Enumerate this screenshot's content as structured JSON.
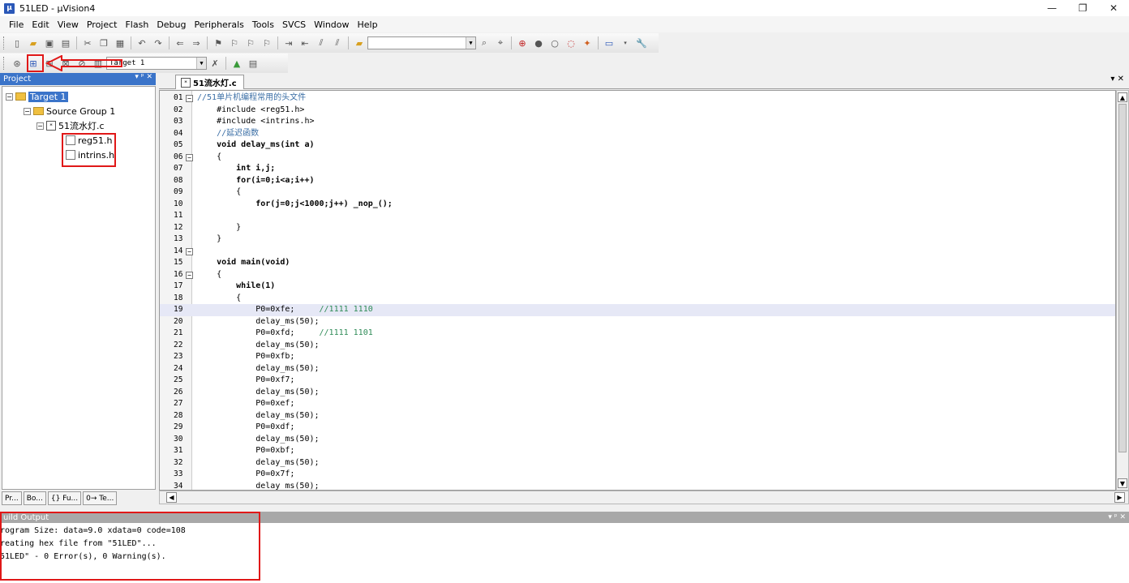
{
  "window": {
    "title": "51LED  - µVision4",
    "controls": {
      "minimize": "—",
      "restore": "❐",
      "close": "✕"
    }
  },
  "menu": [
    "File",
    "Edit",
    "View",
    "Project",
    "Flash",
    "Debug",
    "Peripherals",
    "Tools",
    "SVCS",
    "Window",
    "Help"
  ],
  "toolbar": {
    "target_select": "Target 1"
  },
  "project_panel": {
    "title": "Project",
    "controls": "▾ ᵖ ✕",
    "tree": {
      "target": "Target 1",
      "group": "Source Group 1",
      "file": "51流水灯.c",
      "includes": [
        "reg51.h",
        "intrins.h"
      ]
    },
    "tabs": [
      "Pr...",
      "Bo...",
      "{} Fu...",
      "0→ Te..."
    ]
  },
  "editor": {
    "tab_label": "51流水灯.c",
    "close_label": "▾ ✕",
    "highlight_line": "19",
    "lines": [
      {
        "n": "01",
        "t": "//51单片机编程常用的头文件"
      },
      {
        "n": "02",
        "t": "    #include <reg51.h>"
      },
      {
        "n": "03",
        "t": "    #include <intrins.h>"
      },
      {
        "n": "04",
        "t": "    //延迟函数"
      },
      {
        "n": "05",
        "t": "    void delay_ms(int a)"
      },
      {
        "n": "06",
        "t": "    {"
      },
      {
        "n": "07",
        "t": "        int i,j;"
      },
      {
        "n": "08",
        "t": "        for(i=0;i<a;i++)"
      },
      {
        "n": "09",
        "t": "        {"
      },
      {
        "n": "10",
        "t": "            for(j=0;j<1000;j++) _nop_();"
      },
      {
        "n": "11",
        "t": ""
      },
      {
        "n": "12",
        "t": "        }"
      },
      {
        "n": "13",
        "t": "    }"
      },
      {
        "n": "14",
        "t": ""
      },
      {
        "n": "15",
        "t": "    void main(void)"
      },
      {
        "n": "16",
        "t": "    {"
      },
      {
        "n": "17",
        "t": "        while(1)"
      },
      {
        "n": "18",
        "t": "        {"
      },
      {
        "n": "19",
        "t": "            P0=0xfe;     //1111 1110"
      },
      {
        "n": "20",
        "t": "            delay_ms(50);"
      },
      {
        "n": "21",
        "t": "            P0=0xfd;     //1111 1101"
      },
      {
        "n": "22",
        "t": "            delay_ms(50);"
      },
      {
        "n": "23",
        "t": "            P0=0xfb;"
      },
      {
        "n": "24",
        "t": "            delay_ms(50);"
      },
      {
        "n": "25",
        "t": "            P0=0xf7;"
      },
      {
        "n": "26",
        "t": "            delay_ms(50);"
      },
      {
        "n": "27",
        "t": "            P0=0xef;"
      },
      {
        "n": "28",
        "t": "            delay_ms(50);"
      },
      {
        "n": "29",
        "t": "            P0=0xdf;"
      },
      {
        "n": "30",
        "t": "            delay_ms(50);"
      },
      {
        "n": "31",
        "t": "            P0=0xbf;"
      },
      {
        "n": "32",
        "t": "            delay_ms(50);"
      },
      {
        "n": "33",
        "t": "            P0=0x7f;"
      },
      {
        "n": "34",
        "t": "            delay_ms(50);"
      }
    ]
  },
  "build_output": {
    "title": "uild Output",
    "controls": "▾ ᵖ ✕",
    "lines": [
      "rogram Size: data=9.0 xdata=0 code=108",
      "reating hex file from \"51LED\"...",
      "51LED\" - 0 Error(s), 0 Warning(s)."
    ]
  },
  "colors": {
    "annotation": "#e01818",
    "panel_header": "#3b74c9",
    "highlight_line": "#e6e8f6"
  }
}
